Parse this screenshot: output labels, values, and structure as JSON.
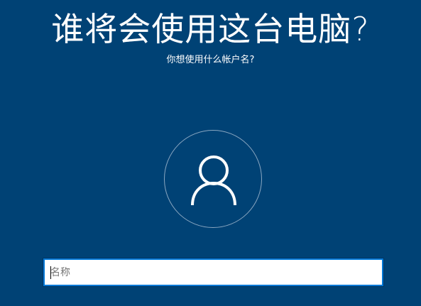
{
  "header": {
    "title": "谁将会使用这台电脑?",
    "subtitle": "你想使用什么帐户名?"
  },
  "avatar": {
    "icon": "user-icon"
  },
  "name_input": {
    "value": "",
    "placeholder": "名称"
  },
  "colors": {
    "background": "#004275",
    "text": "#ffffff",
    "input_border": "#0078d7",
    "avatar_ring": "#8aa7c1"
  }
}
